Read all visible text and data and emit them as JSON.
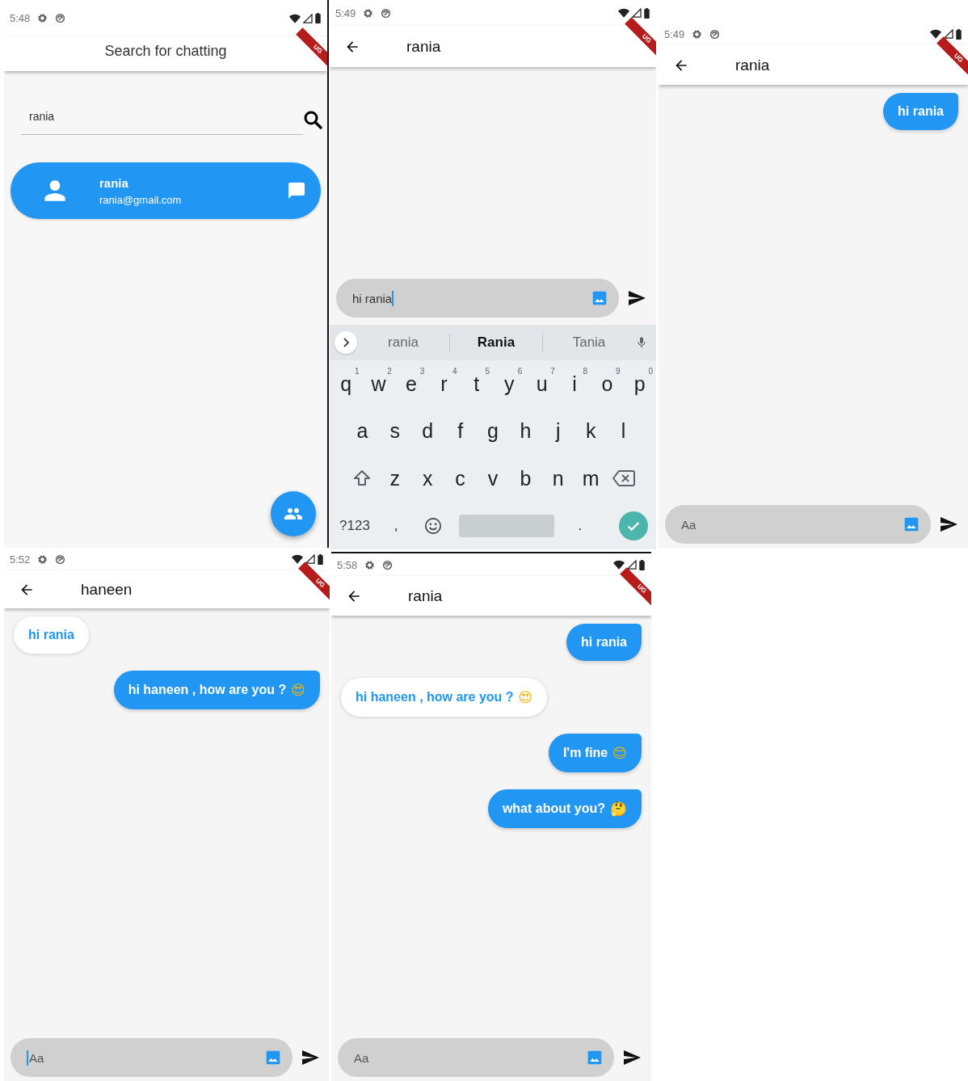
{
  "screens": [
    {
      "kind": "search",
      "time": "5:48",
      "debug_banner": "UG",
      "title": "Search for chatting",
      "search": {
        "value": "rania"
      },
      "results": [
        {
          "name": "rania",
          "email": "rania@gmail.com"
        }
      ]
    },
    {
      "kind": "chat",
      "time": "5:49",
      "debug_banner": "UG",
      "title": "rania",
      "composer": {
        "value": "hi rania",
        "focused": true
      },
      "keyboard": {
        "suggestions": [
          {
            "text": "rania",
            "selected": false
          },
          {
            "text": "Rania",
            "selected": true
          },
          {
            "text": "Tania",
            "selected": false
          }
        ],
        "rows": [
          [
            {
              "kind": "char",
              "label": "q",
              "hint": "1"
            },
            {
              "kind": "char",
              "label": "w",
              "hint": "2"
            },
            {
              "kind": "char",
              "label": "e",
              "hint": "3"
            },
            {
              "kind": "char",
              "label": "r",
              "hint": "4"
            },
            {
              "kind": "char",
              "label": "t",
              "hint": "5"
            },
            {
              "kind": "char",
              "label": "y",
              "hint": "6"
            },
            {
              "kind": "char",
              "label": "u",
              "hint": "7"
            },
            {
              "kind": "char",
              "label": "i",
              "hint": "8"
            },
            {
              "kind": "char",
              "label": "o",
              "hint": "9"
            },
            {
              "kind": "char",
              "label": "p",
              "hint": "0"
            }
          ],
          [
            {
              "kind": "char",
              "label": "a"
            },
            {
              "kind": "char",
              "label": "s"
            },
            {
              "kind": "char",
              "label": "d"
            },
            {
              "kind": "char",
              "label": "f"
            },
            {
              "kind": "char",
              "label": "g"
            },
            {
              "kind": "char",
              "label": "h"
            },
            {
              "kind": "char",
              "label": "j"
            },
            {
              "kind": "char",
              "label": "k"
            },
            {
              "kind": "char",
              "label": "l"
            }
          ],
          [
            {
              "kind": "shift"
            },
            {
              "kind": "char",
              "label": "z"
            },
            {
              "kind": "char",
              "label": "x"
            },
            {
              "kind": "char",
              "label": "c"
            },
            {
              "kind": "char",
              "label": "v"
            },
            {
              "kind": "char",
              "label": "b"
            },
            {
              "kind": "char",
              "label": "n"
            },
            {
              "kind": "char",
              "label": "m"
            },
            {
              "kind": "backspace"
            }
          ],
          [
            {
              "kind": "mode",
              "label": "?123"
            },
            {
              "kind": "char",
              "label": ","
            },
            {
              "kind": "emoji"
            },
            {
              "kind": "space"
            },
            {
              "kind": "char",
              "label": "."
            },
            {
              "kind": "done"
            }
          ]
        ]
      }
    },
    {
      "kind": "chat",
      "time": "5:49",
      "debug_banner": "UG",
      "title": "rania",
      "messages": [
        {
          "text": "hi rania",
          "sent": true
        }
      ],
      "composer": {
        "placeholder": "Aa",
        "focused": false
      }
    },
    {
      "kind": "chat",
      "time": "5:52",
      "debug_banner": "UG",
      "title": "haneen",
      "messages": [
        {
          "text": "hi rania",
          "sent": false
        },
        {
          "text": "hi haneen , how are you ?",
          "sent": true,
          "emoji": "😍"
        }
      ],
      "composer": {
        "placeholder": "Aa",
        "focused": true
      }
    },
    {
      "kind": "chat",
      "time": "5:58",
      "debug_banner": "UG",
      "title": "rania",
      "messages": [
        {
          "text": "hi rania",
          "sent": true
        },
        {
          "text": "hi haneen , how are you ?",
          "sent": false,
          "emoji": "😍"
        },
        {
          "text": "I'm fine",
          "sent": true,
          "emoji": "😊"
        },
        {
          "text": "what about you?",
          "sent": true,
          "emoji": "🤔"
        }
      ],
      "composer": {
        "placeholder": "Aa",
        "focused": false
      }
    }
  ]
}
